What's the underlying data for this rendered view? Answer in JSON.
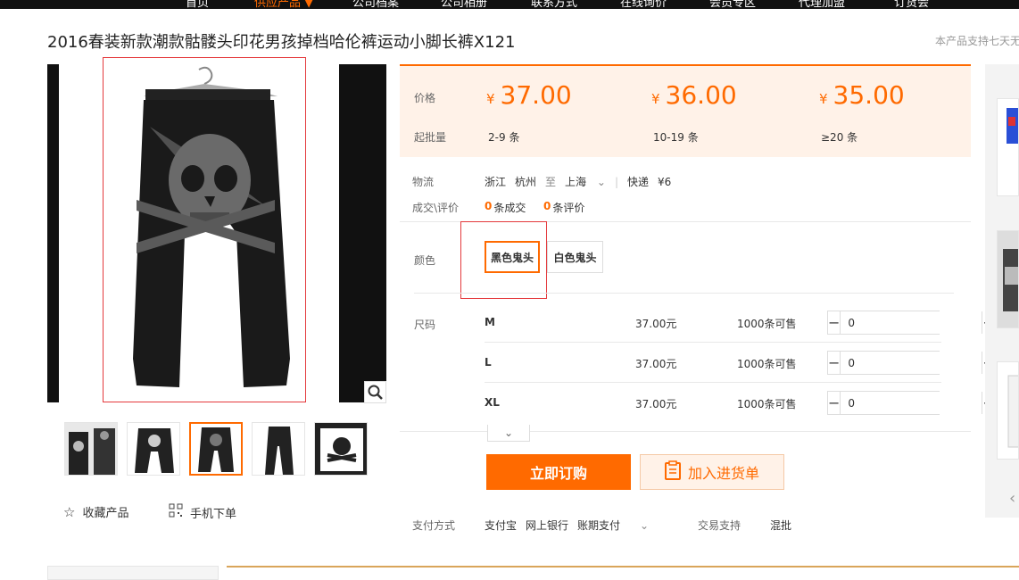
{
  "nav": {
    "items": [
      "首页",
      "供应产品 ▼",
      "公司档案",
      "公司相册",
      "联系方式",
      "在线询价",
      "会员专区",
      "代理加盟",
      "订货会"
    ]
  },
  "product": {
    "title": "2016春装新款潮款骷髅头印花男孩掉档哈伦裤运动小脚长裤X121",
    "notice": "本产品支持七天无"
  },
  "actions": {
    "favorite": "收藏产品",
    "mobile": "手机下单"
  },
  "price": {
    "price_label": "价格",
    "moq_label": "起批量",
    "currency": "¥",
    "tiers": [
      {
        "price": "37.00",
        "qty": "2-9",
        "unit": "条"
      },
      {
        "price": "36.00",
        "qty": "10-19",
        "unit": "条"
      },
      {
        "price": "35.00",
        "qty": "≥20",
        "unit": "条"
      }
    ]
  },
  "logistics": {
    "label": "物流",
    "from_province": "浙江",
    "from_city": "杭州",
    "to_word": "至",
    "to_city": "上海",
    "method": "快递",
    "fee": "¥6"
  },
  "deals": {
    "label": "成交\\评价",
    "deals_count": "0",
    "deals_text": "条成交",
    "review_count": "0",
    "review_text": "条评价"
  },
  "color": {
    "label": "颜色",
    "options": [
      {
        "name": "黑色鬼头",
        "selected": true
      },
      {
        "name": "白色鬼头",
        "selected": false
      }
    ]
  },
  "sizes": {
    "label": "尺码",
    "rows": [
      {
        "name": "M",
        "price": "37.00元",
        "stock": "1000",
        "stock_text": "条可售",
        "qty": "0"
      },
      {
        "name": "L",
        "price": "37.00元",
        "stock": "1000",
        "stock_text": "条可售",
        "qty": "0"
      },
      {
        "name": "XL",
        "price": "37.00元",
        "stock": "1000",
        "stock_text": "条可售",
        "qty": "0"
      }
    ]
  },
  "buttons": {
    "buy": "立即订购",
    "cart": "加入进货单"
  },
  "payment": {
    "label": "支付方式",
    "methods": [
      "支付宝",
      "网上银行",
      "账期支付"
    ],
    "trade_label": "交易支持",
    "trade_value": "混批"
  },
  "colors": {
    "accent": "#ff6a00",
    "price_bg": "#fff2e8",
    "highlight_box": "#e4393c"
  }
}
